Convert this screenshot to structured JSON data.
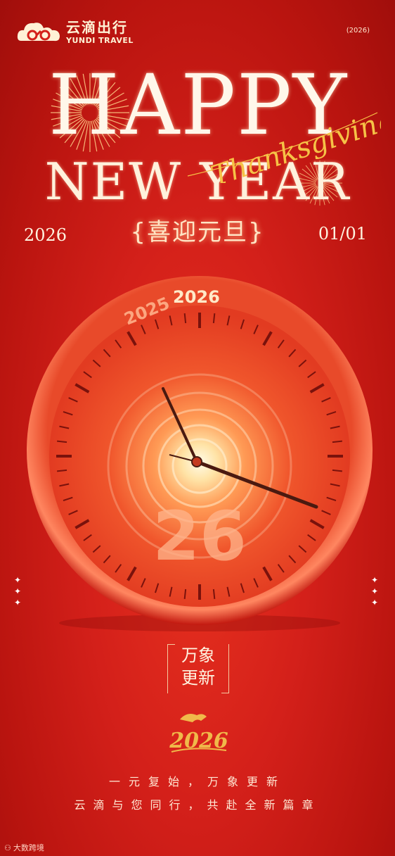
{
  "brand": {
    "name_cn": "云滴出行",
    "name_en": "YUNDI TRAVEL"
  },
  "year_tag": "(2026)",
  "headline": {
    "line1": "HAPPY",
    "line2": "NEW YEAR",
    "script": "Thanksgiving"
  },
  "title_cn": "{喜迎元旦}",
  "dates": {
    "year": "2026",
    "day": "01/01"
  },
  "clock": {
    "past_year": "2025",
    "next_year": "2026",
    "tunnel_number": "26"
  },
  "motto": {
    "line1": "万象",
    "line2": "更新"
  },
  "gold_year": "2026",
  "slogans": {
    "line1": "一元复始，万象更新",
    "line2": "云滴与您同行，共赴全新篇章"
  },
  "watermark": "大数跨境",
  "colors": {
    "background": "#d4201a",
    "accent": "#ffe4c4",
    "gold": "#e9b04a"
  }
}
